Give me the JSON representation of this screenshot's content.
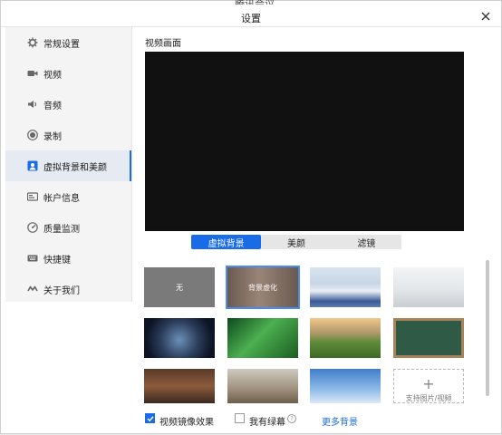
{
  "window": {
    "bg_title_fragment": "腾讯会议",
    "title": "设置"
  },
  "sidebar": {
    "items": [
      {
        "label": "常规设置",
        "icon": "gear-icon"
      },
      {
        "label": "视频",
        "icon": "video-camera-icon"
      },
      {
        "label": "音频",
        "icon": "speaker-icon"
      },
      {
        "label": "录制",
        "icon": "record-icon"
      },
      {
        "label": "虚拟背景和美颜",
        "icon": "portrait-icon",
        "active": true
      },
      {
        "label": "帐户信息",
        "icon": "id-card-icon"
      },
      {
        "label": "质量监测",
        "icon": "gauge-icon"
      },
      {
        "label": "快捷键",
        "icon": "keyboard-icon"
      },
      {
        "label": "关于我们",
        "icon": "about-logo-icon"
      }
    ]
  },
  "main": {
    "section_label": "视频画面",
    "tabs": [
      {
        "label": "虚拟背景",
        "active": true
      },
      {
        "label": "美颜"
      },
      {
        "label": "滤镜"
      }
    ],
    "backgrounds": [
      {
        "label": "无"
      },
      {
        "label": "背景虚化",
        "selected": true
      },
      {
        "label": ""
      },
      {
        "label": ""
      },
      {
        "label": ""
      },
      {
        "label": ""
      },
      {
        "label": ""
      },
      {
        "label": ""
      },
      {
        "label": ""
      },
      {
        "label": ""
      },
      {
        "label": ""
      }
    ],
    "add_tile": {
      "label": "支持图片/视频",
      "icon": "plus-icon"
    },
    "footer": {
      "mirror_label": "视频镜像效果",
      "mirror_checked": true,
      "greenscreen_label": "我有绿幕",
      "greenscreen_checked": false,
      "more_label": "更多背景"
    }
  },
  "colors": {
    "accent": "#1a6be8",
    "preview_bg": "#111111",
    "sidebar_bg": "#f4f4f4"
  }
}
